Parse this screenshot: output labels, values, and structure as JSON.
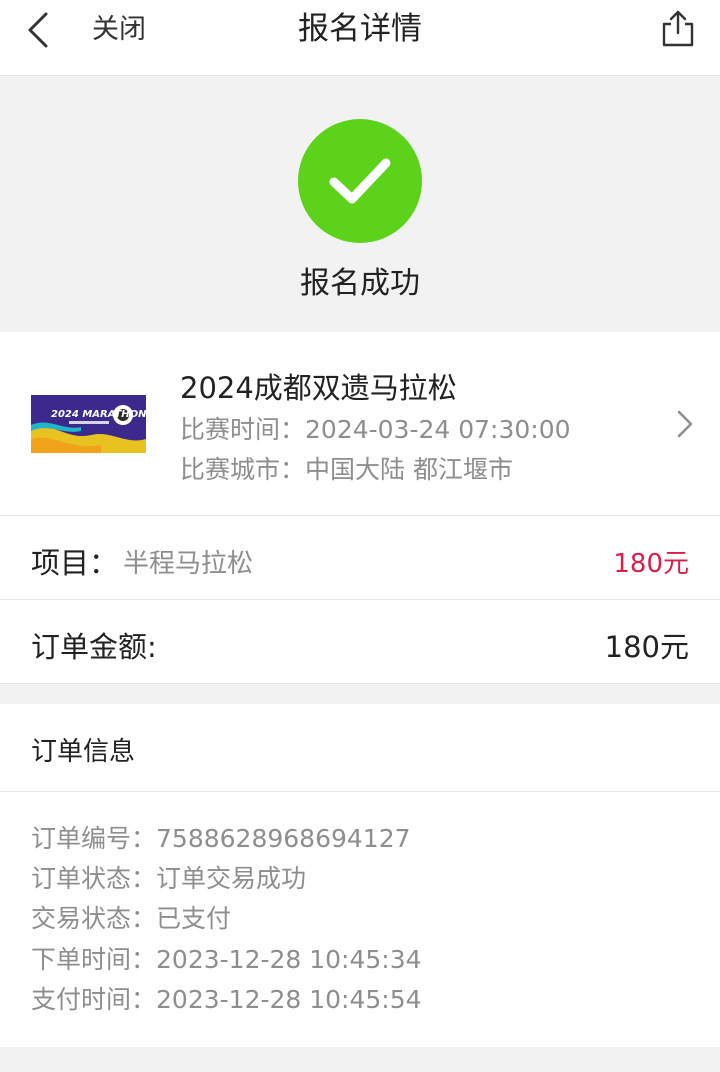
{
  "nav": {
    "close_label": "关闭",
    "title": "报名详情"
  },
  "status": {
    "text": "报名成功",
    "icon_color": "#5cd21a"
  },
  "event": {
    "title": "2024成都双遗马拉松",
    "time_label": "比赛时间：",
    "time_value": "2024-03-24 07:30:00",
    "city_label": "比赛城市：",
    "city_value": "中国大陆 都江堰市",
    "banner_text": "2024 MARATHON"
  },
  "item": {
    "label": "项目：",
    "name": "半程马拉松",
    "price": "180元",
    "price_color": "#d81e4a"
  },
  "order_amount": {
    "label": "订单金额:",
    "value": "180元"
  },
  "order_info": {
    "header": "订单信息",
    "rows": [
      {
        "label": "订单编号：",
        "value": "7588628968694127"
      },
      {
        "label": "订单状态：",
        "value": "订单交易成功"
      },
      {
        "label": "交易状态：",
        "value": "已支付"
      },
      {
        "label": "下单时间：",
        "value": "2023-12-28 10:45:34"
      },
      {
        "label": "支付时间：",
        "value": "2023-12-28 10:45:54"
      }
    ]
  }
}
